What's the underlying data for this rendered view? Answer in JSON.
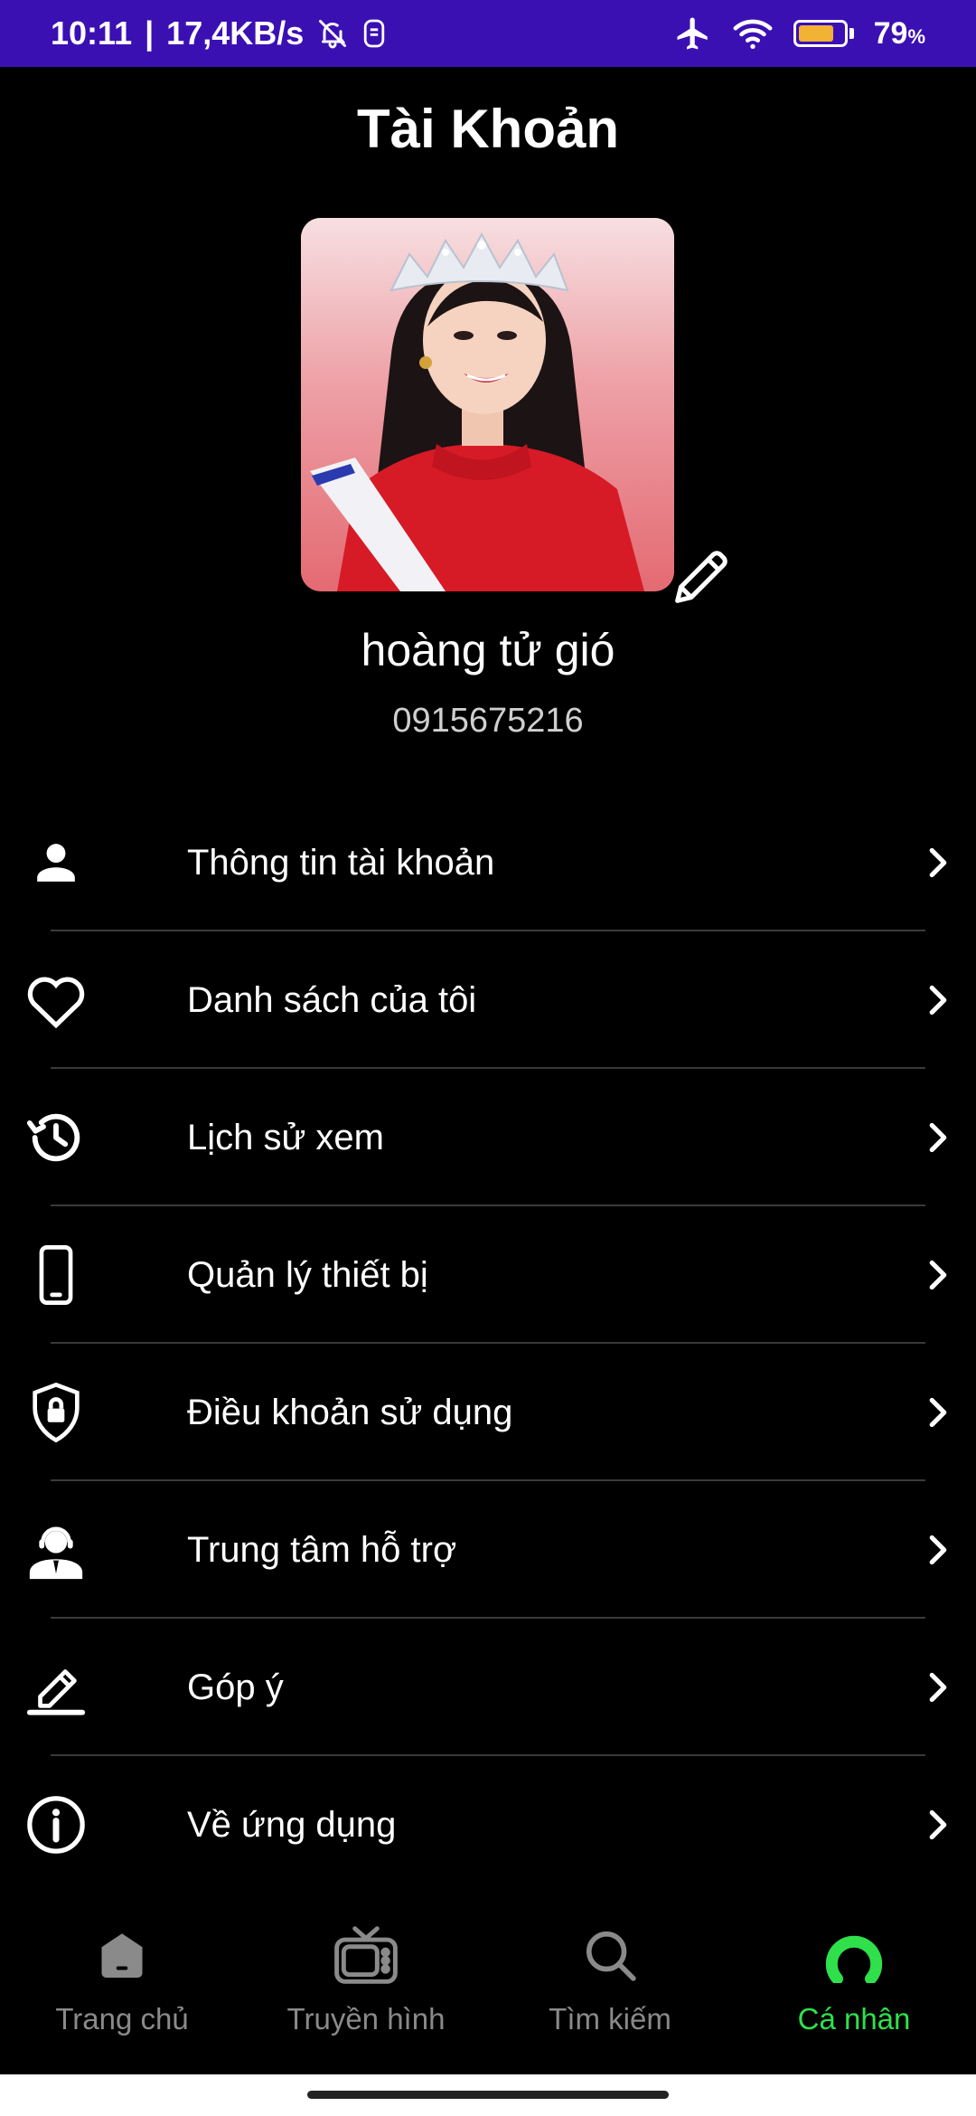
{
  "status_bar": {
    "time": "10:11",
    "network_speed": "17,4KB/s",
    "battery_percent": "79",
    "battery_unit": "%",
    "battery_level": 0.79,
    "bg_color": "#3b10b3"
  },
  "header": {
    "title": "Tài Khoản"
  },
  "profile": {
    "name": "hoàng tử gió",
    "phone": "0915675216",
    "avatar_icon": "avatar-photo",
    "edit_icon": "pencil-icon"
  },
  "menu": {
    "items": [
      {
        "label": "Thông tin tài khoản",
        "icon": "user-icon"
      },
      {
        "label": "Danh sách của tôi",
        "icon": "heart-icon"
      },
      {
        "label": "Lịch sử xem",
        "icon": "history-icon"
      },
      {
        "label": "Quản lý thiết bị",
        "icon": "phone-device-icon"
      },
      {
        "label": "Điều khoản sử dụng",
        "icon": "shield-lock-icon"
      },
      {
        "label": "Trung tâm hỗ trợ",
        "icon": "support-agent-icon"
      },
      {
        "label": "Góp ý",
        "icon": "feedback-pen-icon"
      },
      {
        "label": "Về ứng dụng",
        "icon": "info-icon"
      }
    ]
  },
  "bottom_nav": {
    "items": [
      {
        "label": "Trang chủ",
        "icon": "home-icon",
        "active": false
      },
      {
        "label": "Truyền hình",
        "icon": "tv-icon",
        "active": false
      },
      {
        "label": "Tìm kiếm",
        "icon": "search-icon",
        "active": false
      },
      {
        "label": "Cá nhân",
        "icon": "profile-icon",
        "active": true
      }
    ],
    "active_color": "#2fe04b",
    "inactive_color": "#8a8a8a"
  }
}
